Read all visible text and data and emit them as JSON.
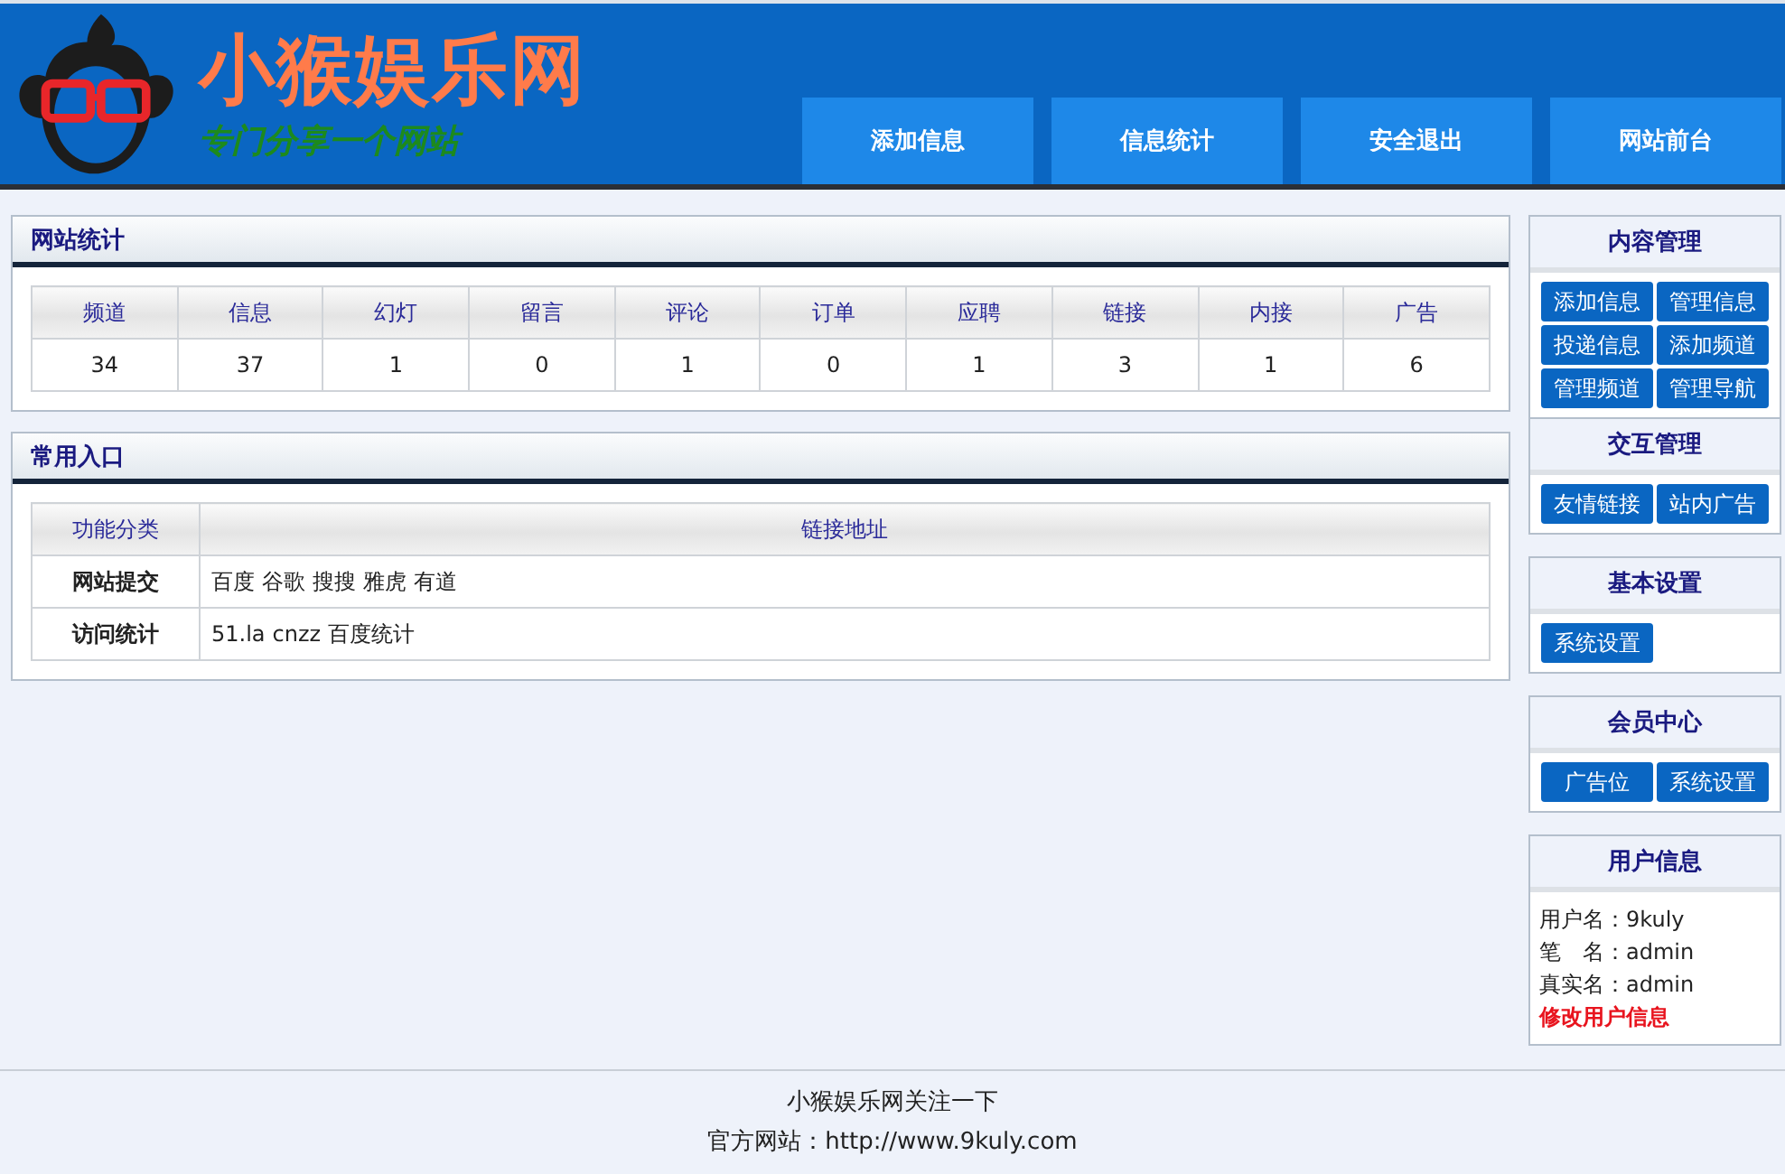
{
  "header": {
    "site_name": "小猴娱乐网",
    "tagline": "专门分享一个网站"
  },
  "nav": [
    "添加信息",
    "信息统计",
    "安全退出",
    "网站前台"
  ],
  "stats": {
    "title": "网站统计",
    "columns": [
      "频道",
      "信息",
      "幻灯",
      "留言",
      "评论",
      "订单",
      "应聘",
      "链接",
      "内接",
      "广告"
    ],
    "values": [
      "34",
      "37",
      "1",
      "0",
      "1",
      "0",
      "1",
      "3",
      "1",
      "6"
    ]
  },
  "entry": {
    "title": "常用入口",
    "columns": [
      "功能分类",
      "链接地址"
    ],
    "rows": [
      {
        "category": "网站提交",
        "links": [
          "百度",
          "谷歌",
          "搜搜",
          "雅虎",
          "有道"
        ]
      },
      {
        "category": "访问统计",
        "links": [
          "51.la",
          "cnzz",
          "百度统计"
        ]
      }
    ]
  },
  "sidebar": [
    {
      "sections": [
        {
          "kind": "buttons",
          "title": "内容管理",
          "buttons": [
            "添加信息",
            "管理信息",
            "投递信息",
            "添加频道",
            "管理频道",
            "管理导航"
          ]
        },
        {
          "kind": "buttons",
          "title": "交互管理",
          "buttons": [
            "友情链接",
            "站内广告"
          ]
        }
      ]
    },
    {
      "sections": [
        {
          "kind": "buttons",
          "title": "基本设置",
          "buttons": [
            "系统设置"
          ]
        }
      ]
    },
    {
      "sections": [
        {
          "kind": "buttons",
          "title": "会员中心",
          "buttons": [
            "广告位",
            "系统设置"
          ]
        }
      ]
    },
    {
      "sections": [
        {
          "kind": "info",
          "title": "用户信息",
          "lines": [
            "用户名：9kuly",
            "笔　名：admin",
            "真实名：admin"
          ],
          "link": "修改用户信息"
        }
      ]
    }
  ],
  "footer": [
    "小猴娱乐网关注一下",
    "官方网站：http://www.9kuly.com"
  ]
}
